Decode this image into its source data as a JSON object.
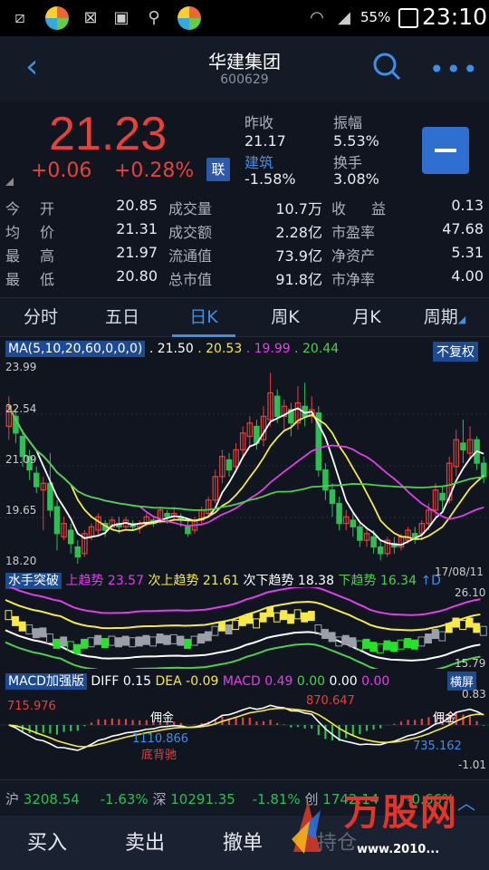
{
  "status_bar": {
    "battery": "55%",
    "time": "23:10",
    "icons": [
      "screenshot-icon",
      "app-icon",
      "blocked-app-icon",
      "image-icon",
      "usb-icon",
      "app-icon",
      "wifi-icon",
      "signal-icon"
    ]
  },
  "header": {
    "title": "华建集团",
    "code": "600629"
  },
  "quote": {
    "price": "21.23",
    "change": "+0.06",
    "change_pct": "+0.28%",
    "lian": "联",
    "prev_close_label": "昨收",
    "prev_close": "21.17",
    "amplitude_label": "振幅",
    "amplitude": "5.53%",
    "sector": "建筑",
    "sector_change": "-1.58%",
    "turnover_label": "换手",
    "turnover": "3.08%"
  },
  "stats": [
    [
      "今",
      "开",
      "20.85",
      "成交量",
      "10.7万",
      "收",
      "益",
      "0.13"
    ],
    [
      "均",
      "价",
      "21.31",
      "成交额",
      "2.28亿",
      "市盈率",
      "",
      "47.68"
    ],
    [
      "最",
      "高",
      "21.97",
      "流通值",
      "73.9亿",
      "净资产",
      "",
      "5.31"
    ],
    [
      "最",
      "低",
      "20.80",
      "总市值",
      "91.8亿",
      "市净率",
      "",
      "4.00"
    ]
  ],
  "tabs": [
    "分时",
    "五日",
    "日K",
    "周K",
    "月K",
    "周期"
  ],
  "ma": {
    "label": "MA(5,10,20,60,0,0,0)",
    "v1": ". 21.50",
    "v2": ". 20.53",
    "v3": ". 19.99",
    "v4": ". 20.44",
    "fq": "不复权",
    "y_ticks": [
      "23.99",
      "22.54",
      "21.09",
      "19.65",
      "18.20"
    ],
    "date": "17/08/11"
  },
  "sailor": {
    "label": "水手突破",
    "t1": "上趋势",
    "v1": "23.57",
    "t2": "次上趋势",
    "v2": "21.61",
    "t3": "次下趋势",
    "v3": "18.38",
    "t4": "下趋势",
    "v4": "16.34",
    "t5": "↑D",
    "top": "26.10",
    "bottom": "15.79"
  },
  "macd": {
    "label": "MACD加强版",
    "diff": "DIFF",
    "diff_v": "0.15",
    "dea": "DEA",
    "dea_v": "-0.09",
    "macd": "MACD",
    "macd_v": "0.49",
    "z1": "0.00",
    "z2": "0.00",
    "z3": "0.00",
    "hp": "横屏",
    "top": "0.83",
    "bottom": "-1.01",
    "a1": "715.976",
    "a2": "870.647",
    "a3": "1110.866",
    "a4": "735.162",
    "note1": "佣金",
    "note2": "底背驰",
    "note3": "佣金"
  },
  "indices": [
    {
      "name": "沪",
      "value": "3208.54",
      "change": "-1.63%"
    },
    {
      "name": "深",
      "value": "10291.35",
      "change": "-1.81%"
    },
    {
      "name": "创",
      "value": "1742.14",
      "change": "-0.66%"
    }
  ],
  "bottom_bar": {
    "buy": "买入",
    "sell": "卖出",
    "cancel": "撤单",
    "hold": "持仓",
    "watermark": "万股网",
    "watermark_url": "www.2010..."
  },
  "chart_data": {
    "type": "candlestick",
    "ylim": [
      18.2,
      23.99
    ],
    "candles": [
      [
        22.3,
        22.9,
        21.9,
        23.2
      ],
      [
        22.6,
        22.1,
        21.8,
        22.8
      ],
      [
        22.0,
        21.4,
        21.1,
        22.2
      ],
      [
        21.4,
        21.0,
        20.7,
        21.6
      ],
      [
        20.9,
        20.5,
        20.3,
        21.1
      ],
      [
        20.4,
        20.6,
        19.2,
        20.8
      ],
      [
        20.6,
        19.8,
        19.6,
        21.5
      ],
      [
        19.9,
        19.1,
        18.6,
        20.1
      ],
      [
        19.0,
        19.4,
        18.9,
        19.6
      ],
      [
        19.2,
        18.8,
        18.5,
        19.4
      ],
      [
        18.7,
        18.4,
        18.2,
        18.9
      ],
      [
        18.5,
        19.1,
        18.4,
        19.2
      ],
      [
        19.0,
        19.3,
        18.9,
        19.4
      ],
      [
        19.2,
        19.6,
        19.0,
        19.7
      ],
      [
        19.4,
        19.2,
        19.0,
        19.5
      ],
      [
        19.3,
        19.5,
        19.2,
        19.6
      ],
      [
        19.4,
        19.3,
        19.1,
        19.6
      ],
      [
        19.3,
        19.5,
        19.2,
        19.6
      ],
      [
        19.4,
        19.3,
        19.2,
        19.5
      ],
      [
        19.3,
        19.4,
        19.1,
        19.5
      ],
      [
        19.4,
        19.6,
        19.3,
        19.7
      ],
      [
        19.5,
        19.4,
        19.3,
        19.6
      ],
      [
        19.5,
        19.8,
        19.4,
        19.9
      ],
      [
        19.7,
        19.6,
        19.4,
        19.8
      ],
      [
        19.6,
        19.7,
        19.5,
        19.9
      ],
      [
        19.6,
        19.5,
        19.3,
        19.7
      ],
      [
        19.3,
        19.1,
        19.0,
        19.5
      ],
      [
        19.2,
        19.5,
        19.1,
        19.6
      ],
      [
        19.5,
        19.8,
        19.4,
        19.9
      ],
      [
        19.7,
        20.1,
        19.6,
        20.2
      ],
      [
        20.1,
        20.8,
        20.0,
        21.0
      ],
      [
        20.8,
        21.4,
        20.6,
        21.6
      ],
      [
        21.3,
        21.0,
        20.8,
        21.5
      ],
      [
        21.1,
        21.6,
        21.0,
        21.8
      ],
      [
        21.6,
        22.1,
        21.4,
        22.3
      ],
      [
        22.0,
        22.4,
        21.7,
        22.6
      ],
      [
        22.3,
        21.8,
        21.6,
        22.5
      ],
      [
        21.9,
        22.6,
        21.7,
        22.9
      ],
      [
        22.5,
        23.3,
        22.3,
        23.9
      ],
      [
        23.2,
        22.6,
        22.4,
        23.4
      ],
      [
        22.6,
        22.9,
        22.2,
        23.1
      ],
      [
        22.8,
        22.4,
        22.0,
        23.0
      ],
      [
        22.4,
        23.0,
        22.2,
        23.5
      ],
      [
        22.9,
        22.6,
        22.3,
        23.6
      ],
      [
        22.6,
        22.8,
        22.4,
        23.2
      ],
      [
        22.7,
        21.0,
        20.8,
        22.9
      ],
      [
        21.0,
        20.4,
        20.1,
        21.2
      ],
      [
        20.4,
        20.0,
        19.6,
        20.6
      ],
      [
        20.0,
        19.4,
        19.2,
        20.2
      ],
      [
        19.4,
        19.6,
        19.2,
        19.8
      ],
      [
        19.5,
        19.3,
        19.0,
        19.7
      ],
      [
        19.3,
        18.9,
        18.7,
        19.4
      ],
      [
        18.9,
        19.1,
        18.7,
        19.3
      ],
      [
        19.0,
        18.7,
        18.5,
        19.2
      ],
      [
        18.7,
        18.5,
        18.3,
        18.9
      ],
      [
        18.5,
        18.9,
        18.4,
        19.0
      ],
      [
        18.8,
        18.7,
        18.5,
        19.0
      ],
      [
        18.7,
        19.0,
        18.6,
        19.1
      ],
      [
        18.9,
        19.2,
        18.8,
        19.3
      ],
      [
        19.1,
        19.0,
        18.8,
        19.3
      ],
      [
        19.1,
        19.4,
        18.9,
        19.5
      ],
      [
        19.4,
        19.8,
        19.2,
        20.0
      ],
      [
        19.8,
        20.4,
        19.6,
        20.6
      ],
      [
        20.3,
        20.1,
        19.8,
        20.5
      ],
      [
        20.1,
        21.2,
        20.0,
        21.4
      ],
      [
        21.1,
        21.9,
        20.8,
        22.2
      ],
      [
        21.8,
        21.6,
        21.2,
        22.5
      ],
      [
        21.5,
        21.9,
        21.3,
        22.3
      ],
      [
        21.9,
        21.2,
        21.0,
        22.0
      ],
      [
        21.2,
        20.8,
        20.6,
        21.4
      ]
    ]
  }
}
